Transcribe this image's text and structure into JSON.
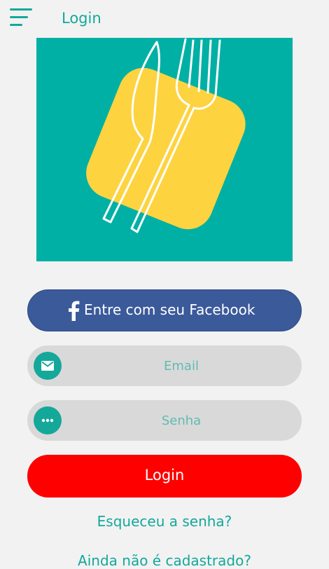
{
  "header": {
    "title": "Login",
    "menu_icon": "hamburger-menu-icon"
  },
  "hero": {
    "icon": "fork-and-knife-logo",
    "background_color": "#00b0a5",
    "tile_color": "#fdd340"
  },
  "facebook_button": {
    "label": "Entre com seu Facebook",
    "icon": "facebook-icon",
    "color": "#3b5a9a"
  },
  "email_field": {
    "placeholder": "Email",
    "value": "",
    "icon": "envelope-icon"
  },
  "password_field": {
    "placeholder": "Senha",
    "value": "",
    "icon": "dots-icon"
  },
  "login_button": {
    "label": "Login",
    "color": "#ff0000"
  },
  "links": {
    "forgot_password": "Esqueceu a senha?",
    "signup": "Ainda não é cadastrado?"
  },
  "colors": {
    "accent": "#14a89a",
    "background": "#f2f2f2"
  }
}
